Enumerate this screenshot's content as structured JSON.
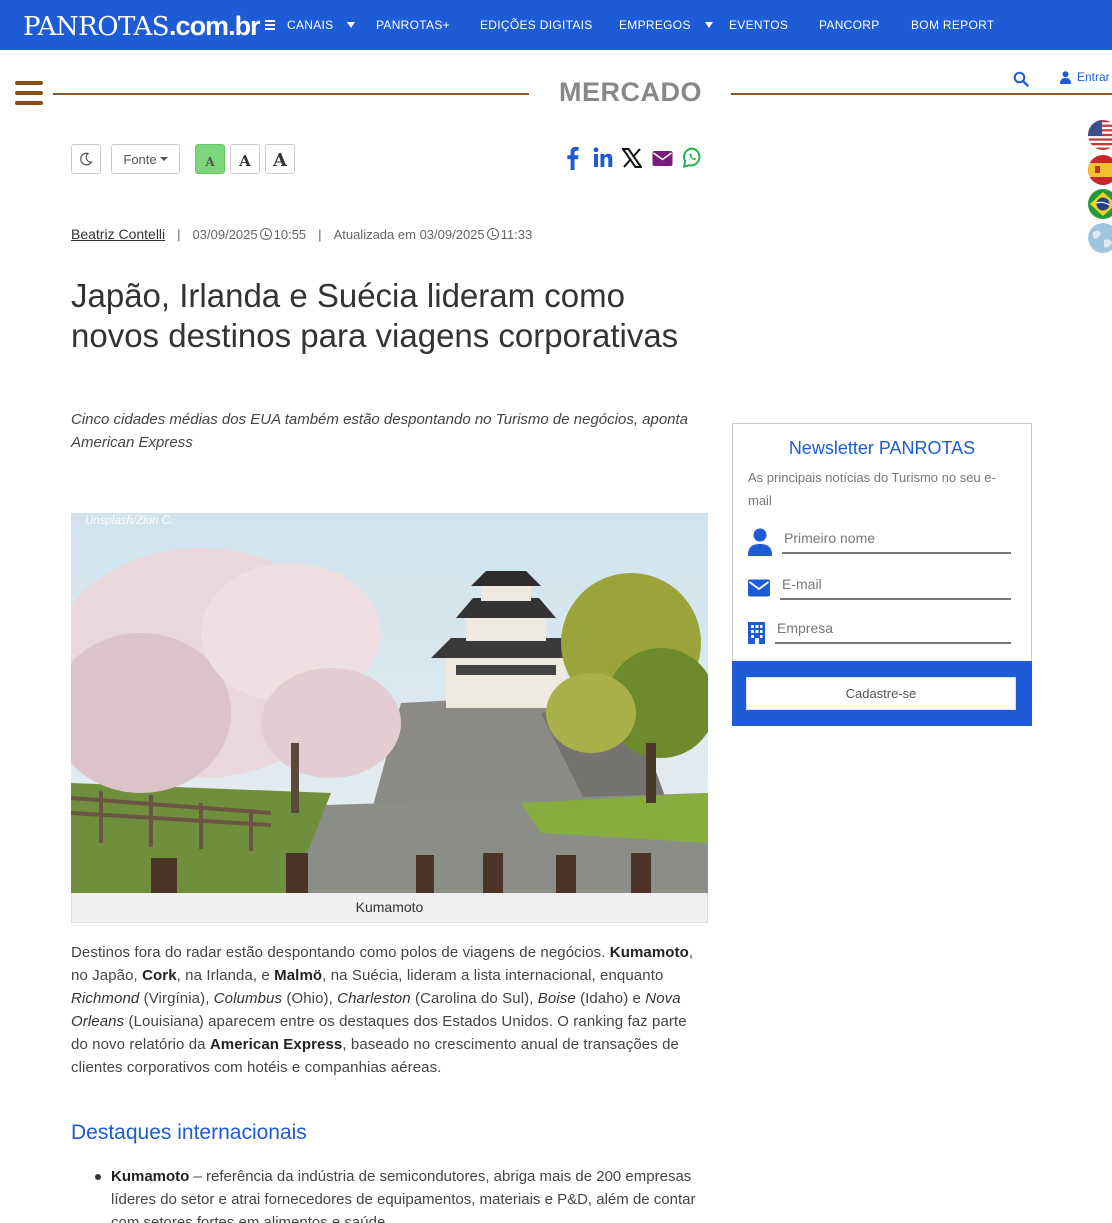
{
  "header": {
    "logo_main": "PANROTAS",
    "logo_domain": ".com.br",
    "nav": [
      {
        "label": "CANAIS"
      },
      {
        "label": "PANROTAS+"
      },
      {
        "label": "EDIÇÕES DIGITAIS"
      },
      {
        "label": "EMPREGOS"
      },
      {
        "label": "EVENTOS"
      },
      {
        "label": "PANCORP"
      },
      {
        "label": "BOM REPORT"
      }
    ],
    "login_label": "Entrar"
  },
  "section": {
    "title": "MERCADO"
  },
  "toolbar": {
    "font_label": "Fonte",
    "font_small": "A",
    "font_medium": "A",
    "font_large": "A"
  },
  "article": {
    "author": "Beatriz Contelli",
    "published_date": "03/09/2025",
    "published_time": "10:55",
    "updated_prefix": "Atualizada em",
    "updated_date": "03/09/2025",
    "updated_time": "11:33",
    "title": "Japão, Irlanda e Suécia lideram como novos destinos para viagens corporativas",
    "subtitle": "Cinco cidades médias dos EUA também estão despontando no Turismo de negócios, aponta American Express",
    "photo_credit": "Unsplash/Zion C.",
    "photo_caption": "Kumamoto",
    "p1": {
      "t1": "Destinos fora do radar estão despontando como polos de viagens de negócios. ",
      "b1": "Kumamoto",
      "t2": ", no Japão, ",
      "b2": "Cork",
      "t3": ", na Irlanda, e ",
      "b3": "Malmö",
      "t4": ", na Suécia, lideram a lista internacional, enquanto ",
      "i1": "Richmond",
      "t5": " (Virgínia), ",
      "i2": "Columbus",
      "t6": " (Ohio), ",
      "i3": "Charleston",
      "t7": " (Carolina do Sul), ",
      "i4": "Boise",
      "t8": " (Idaho) e ",
      "i5": "Nova Orleans",
      "t9": " (Louisiana) aparecem entre os destaques dos Estados Unidos. O ranking faz parte do novo relatório da ",
      "b4": "American Express",
      "t10": ", baseado no crescimento anual de transações de clientes corporativos com hotéis e companhias aéreas."
    },
    "subhead": "Destaques internacionais",
    "bullet1": {
      "b": "Kumamoto",
      "t": " – referência da indústria de semicondutores, abriga mais de 200 empresas líderes do setor e atrai fornecedores de equipamentos, materiais e P&D, além de contar com setores fortes em alimentos e saúde."
    }
  },
  "newsletter": {
    "title": "Newsletter PANROTAS",
    "description": "As principais notícias do Turismo no seu e-mail",
    "first_name_placeholder": "Primeiro nome",
    "email_placeholder": "E-mail",
    "company_placeholder": "Empresa",
    "submit_label": "Cadastre-se"
  },
  "icons": {
    "theme": "moon-icon",
    "share": [
      "facebook-icon",
      "linkedin-icon",
      "x-icon",
      "email-icon",
      "whatsapp-icon"
    ],
    "languages": [
      "flag-us-icon",
      "flag-es-icon",
      "flag-br-icon",
      "globe-icon"
    ]
  },
  "colors": {
    "brand_blue": "#1e5bd6",
    "section_rule": "#8b5a2b",
    "active_font_button": "#7cd67c",
    "email_purple": "#7a1d7a",
    "whatsapp_green": "#25b14a"
  }
}
